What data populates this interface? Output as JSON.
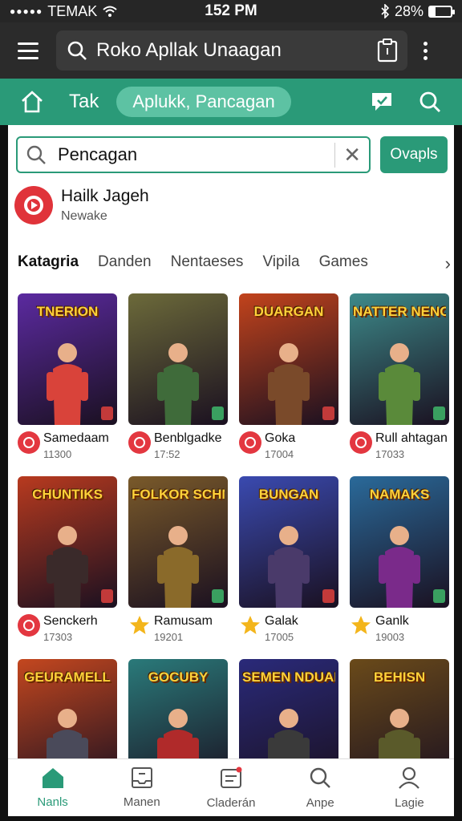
{
  "status_bar": {
    "carrier": "TEMAK",
    "time": "152 PM",
    "battery": "28%",
    "battery_level": 0.28
  },
  "app_bar": {
    "title": "Roko Apllak Unaagan",
    "icons": [
      "menu-icon",
      "search-icon",
      "clipboard-icon",
      "more-icon"
    ]
  },
  "nav": {
    "tab_1": "Tak",
    "active_tab": "Aplukk, Pancagan",
    "icons": [
      "home-icon",
      "chat-icon",
      "search-icon"
    ]
  },
  "search": {
    "value": "Pencagan",
    "button_label": "Ovapls"
  },
  "suggestion": {
    "title": "Hailk Jageh",
    "subtitle": "Newake"
  },
  "categories": [
    "Katagria",
    "Danden",
    "Nentaeses",
    "Vipila",
    "Games"
  ],
  "games": [
    {
      "title": "TNERION",
      "name": "Samedaam",
      "num": "11300",
      "icon": "red-circle-icon",
      "bg": "#5b2aa0",
      "accent": "#d9433a"
    },
    {
      "title": "",
      "name": "Benblgadke",
      "num": "17:52",
      "icon": "red-circle-icon",
      "bg": "#6c6a3a",
      "accent": "#3f6b3a"
    },
    {
      "title": "DUARGAN",
      "name": "Goka",
      "num": "17004",
      "icon": "red-circle-icon",
      "bg": "#c2431c",
      "accent": "#7a4a2a"
    },
    {
      "title": "NATTER NENOSIA",
      "name": "Rull ahtagan",
      "num": "17033",
      "icon": "red-circle-icon",
      "bg": "#3d8a8a",
      "accent": "#5a8a3a"
    },
    {
      "title": "CHUNTIKS",
      "name": "Senckerh",
      "num": "17303",
      "icon": "red-circle-icon",
      "bg": "#b83a1f",
      "accent": "#3a2a2a"
    },
    {
      "title": "FOLKOR SCHNAUR",
      "name": "Ramusam",
      "num": "19201",
      "icon": "star-icon",
      "bg": "#7a5a2a",
      "accent": "#8a6a2a"
    },
    {
      "title": "BUNGAN",
      "name": "Galak",
      "num": "17005",
      "icon": "star-icon",
      "bg": "#3a4ab0",
      "accent": "#4a3a6a"
    },
    {
      "title": "NAMAKS",
      "name": "Ganlk",
      "num": "19003",
      "icon": "star-icon",
      "bg": "#2a6a9a",
      "accent": "#7a2a8a"
    },
    {
      "title": "GEURAMELL",
      "name": "",
      "num": "",
      "icon": "",
      "bg": "#c4471f",
      "accent": "#4a4a5a"
    },
    {
      "title": "GOCUBY",
      "name": "",
      "num": "",
      "icon": "",
      "bg": "#2a7a7a",
      "accent": "#b02a2a"
    },
    {
      "title": "SEMEN NDUANE",
      "name": "",
      "num": "",
      "icon": "",
      "bg": "#2a2a7a",
      "accent": "#3a3a3a"
    },
    {
      "title": "BEHISN",
      "name": "",
      "num": "",
      "icon": "",
      "bg": "#6a4a1a",
      "accent": "#5a5a2a"
    }
  ],
  "bottom_nav": [
    {
      "label": "Nanls",
      "icon": "home-icon",
      "active": true
    },
    {
      "label": "Manen",
      "icon": "inbox-icon",
      "active": false
    },
    {
      "label": "Claderán",
      "icon": "calendar-icon",
      "active": false
    },
    {
      "label": "Anpe",
      "icon": "search-icon",
      "active": false
    },
    {
      "label": "Lagie",
      "icon": "user-icon",
      "active": false
    }
  ]
}
